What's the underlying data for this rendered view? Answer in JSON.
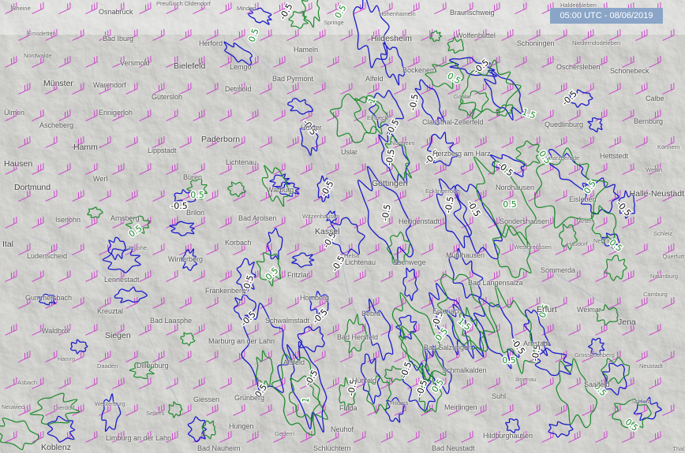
{
  "timestamp": "05:00 UTC - 08/06/2019",
  "colors": {
    "wind_barb": "#cc44cc",
    "contour_negative": "#1a1acc",
    "contour_positive": "#1a8a2a",
    "timestamp_bg": "#8aa5c7"
  },
  "contour_levels": [
    "-0.5",
    "0.5",
    "1",
    "1.5"
  ],
  "cities": [
    {
      "name": "Rheine",
      "size": "small"
    },
    {
      "name": "Osnabrück",
      "size": "normal"
    },
    {
      "name": "Preußisch Oldendorf",
      "size": "small"
    },
    {
      "name": "Minden",
      "size": "small"
    },
    {
      "name": "Springe",
      "size": "small"
    },
    {
      "name": "Hohenhameln",
      "size": "small"
    },
    {
      "name": "Braunschweig",
      "size": "normal"
    },
    {
      "name": "Haldensleben",
      "size": "small"
    },
    {
      "name": "Emsdetten",
      "size": "small"
    },
    {
      "name": "Bad Iburg",
      "size": "normal"
    },
    {
      "name": "Herford",
      "size": "normal"
    },
    {
      "name": "Hameln",
      "size": "normal"
    },
    {
      "name": "Hildesheim",
      "size": "big"
    },
    {
      "name": "Wolfenbüttel",
      "size": "normal"
    },
    {
      "name": "Schoningen",
      "size": "normal"
    },
    {
      "name": "Niederndodeleben",
      "size": "small"
    },
    {
      "name": "Nordwalde",
      "size": "small"
    },
    {
      "name": "Versmold",
      "size": "normal"
    },
    {
      "name": "Bielefeld",
      "size": "big"
    },
    {
      "name": "Lemgo",
      "size": "normal"
    },
    {
      "name": "Bad Pyrmont",
      "size": "normal"
    },
    {
      "name": "Alfeld",
      "size": "normal"
    },
    {
      "name": "Bockenem",
      "size": "normal"
    },
    {
      "name": "Oschersleben",
      "size": "normal"
    },
    {
      "name": "Schonebeck",
      "size": "normal"
    },
    {
      "name": "Münster",
      "size": "big"
    },
    {
      "name": "Warendorf",
      "size": "normal"
    },
    {
      "name": "Detmold",
      "size": "normal"
    },
    {
      "name": "Gütersloh",
      "size": "normal"
    },
    {
      "name": "Goslar",
      "size": "small"
    },
    {
      "name": "Ülmen",
      "size": "normal"
    },
    {
      "name": "Ennigerloh",
      "size": "normal"
    },
    {
      "name": "Einbeck",
      "size": "small"
    },
    {
      "name": "Clausthal-Zellerfeld",
      "size": "normal"
    },
    {
      "name": "Quedlinburg",
      "size": "normal"
    },
    {
      "name": "Calbe",
      "size": "normal"
    },
    {
      "name": "Bernburg",
      "size": "normal"
    },
    {
      "name": "Ascheberg",
      "size": "normal"
    },
    {
      "name": "Hamm",
      "size": "big"
    },
    {
      "name": "Lippstadt",
      "size": "normal"
    },
    {
      "name": "Paderborn",
      "size": "big"
    },
    {
      "name": "Höxter",
      "size": "normal"
    },
    {
      "name": "Uslar",
      "size": "normal"
    },
    {
      "name": "Northeim",
      "size": "small"
    },
    {
      "name": "Herzberg am Harz",
      "size": "normal"
    },
    {
      "name": "Harzgerode",
      "size": "small"
    },
    {
      "name": "Hettstedt",
      "size": "normal"
    },
    {
      "name": "Könnern",
      "size": "small"
    },
    {
      "name": "Wettin",
      "size": "small"
    },
    {
      "name": "Hausen",
      "size": "big"
    },
    {
      "name": "Lichtenau",
      "size": "normal"
    },
    {
      "name": "Dortmund",
      "size": "big"
    },
    {
      "name": "Werl",
      "size": "normal"
    },
    {
      "name": "Büren",
      "size": "normal"
    },
    {
      "name": "Warburg",
      "size": "normal"
    },
    {
      "name": "Göttingen",
      "size": "big"
    },
    {
      "name": "Ecklingerode",
      "size": "small"
    },
    {
      "name": "Nordhausen",
      "size": "normal"
    },
    {
      "name": "Eisleben",
      "size": "normal"
    },
    {
      "name": "Halle-Neustadt",
      "size": "big"
    },
    {
      "name": "Brilon",
      "size": "normal"
    },
    {
      "name": "Iserlohn",
      "size": "normal"
    },
    {
      "name": "Arnsberg",
      "size": "normal"
    },
    {
      "name": "Bad Arolsen",
      "size": "normal"
    },
    {
      "name": "Witzenhausen",
      "size": "small"
    },
    {
      "name": "Heiligenstadt",
      "size": "normal"
    },
    {
      "name": "Sondershausen",
      "size": "normal"
    },
    {
      "name": "Artern",
      "size": "small"
    },
    {
      "name": "Schleiz",
      "size": "small"
    },
    {
      "name": "Kassel",
      "size": "big"
    },
    {
      "name": "Ital",
      "size": "big"
    },
    {
      "name": "Korbach",
      "size": "normal"
    },
    {
      "name": "Eslohe",
      "size": "small"
    },
    {
      "name": "Ludenscheid",
      "size": "normal"
    },
    {
      "name": "Helsa",
      "size": "small"
    },
    {
      "name": "Lichtenau",
      "size": "normal"
    },
    {
      "name": "Eschwege",
      "size": "normal"
    },
    {
      "name": "Westgreussen",
      "size": "small"
    },
    {
      "name": "Nebra",
      "size": "small"
    },
    {
      "name": "Haudorf",
      "size": "small"
    },
    {
      "name": "Querfurt",
      "size": "small"
    },
    {
      "name": "Winterberg",
      "size": "normal"
    },
    {
      "name": "Mühlhausen",
      "size": "normal"
    },
    {
      "name": "Lennestadt",
      "size": "normal"
    },
    {
      "name": "Fritzlar",
      "size": "normal"
    },
    {
      "name": "Sommerda",
      "size": "normal"
    },
    {
      "name": "Naumburg",
      "size": "small"
    },
    {
      "name": "Frankenberg",
      "size": "normal"
    },
    {
      "name": "Bad Langensalza",
      "size": "normal"
    },
    {
      "name": "Gummersbach",
      "size": "normal"
    },
    {
      "name": "Homberg",
      "size": "normal"
    },
    {
      "name": "Camburg",
      "size": "small"
    },
    {
      "name": "Kreuztal",
      "size": "normal"
    },
    {
      "name": "Bad Laasphe",
      "size": "normal"
    },
    {
      "name": "Schwalmstadt",
      "size": "normal"
    },
    {
      "name": "Bebra",
      "size": "normal"
    },
    {
      "name": "Eisenach",
      "size": "normal"
    },
    {
      "name": "Erfurt",
      "size": "big"
    },
    {
      "name": "Weimar",
      "size": "normal"
    },
    {
      "name": "Jena",
      "size": "big"
    },
    {
      "name": "Waldbröl",
      "size": "normal"
    },
    {
      "name": "Siegen",
      "size": "big"
    },
    {
      "name": "Marburg an der Lahn",
      "size": "normal"
    },
    {
      "name": "Bad Hersfeld",
      "size": "normal"
    },
    {
      "name": "Arnstadt",
      "size": "normal"
    },
    {
      "name": "Hamm",
      "size": "small"
    },
    {
      "name": "Alsfeld",
      "size": "normal"
    },
    {
      "name": "Bad Salzungen",
      "size": "normal"
    },
    {
      "name": "Grosskochberg",
      "size": "small"
    },
    {
      "name": "Daaden",
      "size": "small"
    },
    {
      "name": "Dillenburg",
      "size": "normal"
    },
    {
      "name": "Hünfeld",
      "size": "normal"
    },
    {
      "name": "Schmalkalden",
      "size": "normal"
    },
    {
      "name": "Neustadt",
      "size": "small"
    },
    {
      "name": "Asbach",
      "size": "small"
    },
    {
      "name": "Ilmenau",
      "size": "small"
    },
    {
      "name": "Saalfeld",
      "size": "normal"
    },
    {
      "name": "Suhl",
      "size": "normal"
    },
    {
      "name": "Westerburg",
      "size": "small"
    },
    {
      "name": "Grünberg",
      "size": "normal"
    },
    {
      "name": "Giessen",
      "size": "normal"
    },
    {
      "name": "Fulda",
      "size": "normal"
    },
    {
      "name": "Hilders",
      "size": "small"
    },
    {
      "name": "Meiningen",
      "size": "normal"
    },
    {
      "name": "Schleiz",
      "size": "small"
    },
    {
      "name": "Neuwied",
      "size": "small"
    },
    {
      "name": "Dierdorf",
      "size": "small"
    },
    {
      "name": "Selters",
      "size": "small"
    },
    {
      "name": "Hungen",
      "size": "normal"
    },
    {
      "name": "Neuhof",
      "size": "normal"
    },
    {
      "name": "Hildburghausen",
      "size": "normal"
    },
    {
      "name": "Gedern",
      "size": "small"
    },
    {
      "name": "Bad Neustadt",
      "size": "normal"
    },
    {
      "name": "Limburg an der Lahn",
      "size": "normal"
    },
    {
      "name": "Koblenz",
      "size": "big"
    },
    {
      "name": "Bad Nauheim",
      "size": "normal"
    },
    {
      "name": "Schlüchtern",
      "size": "normal"
    },
    {
      "name": "Thal",
      "size": "small"
    }
  ]
}
